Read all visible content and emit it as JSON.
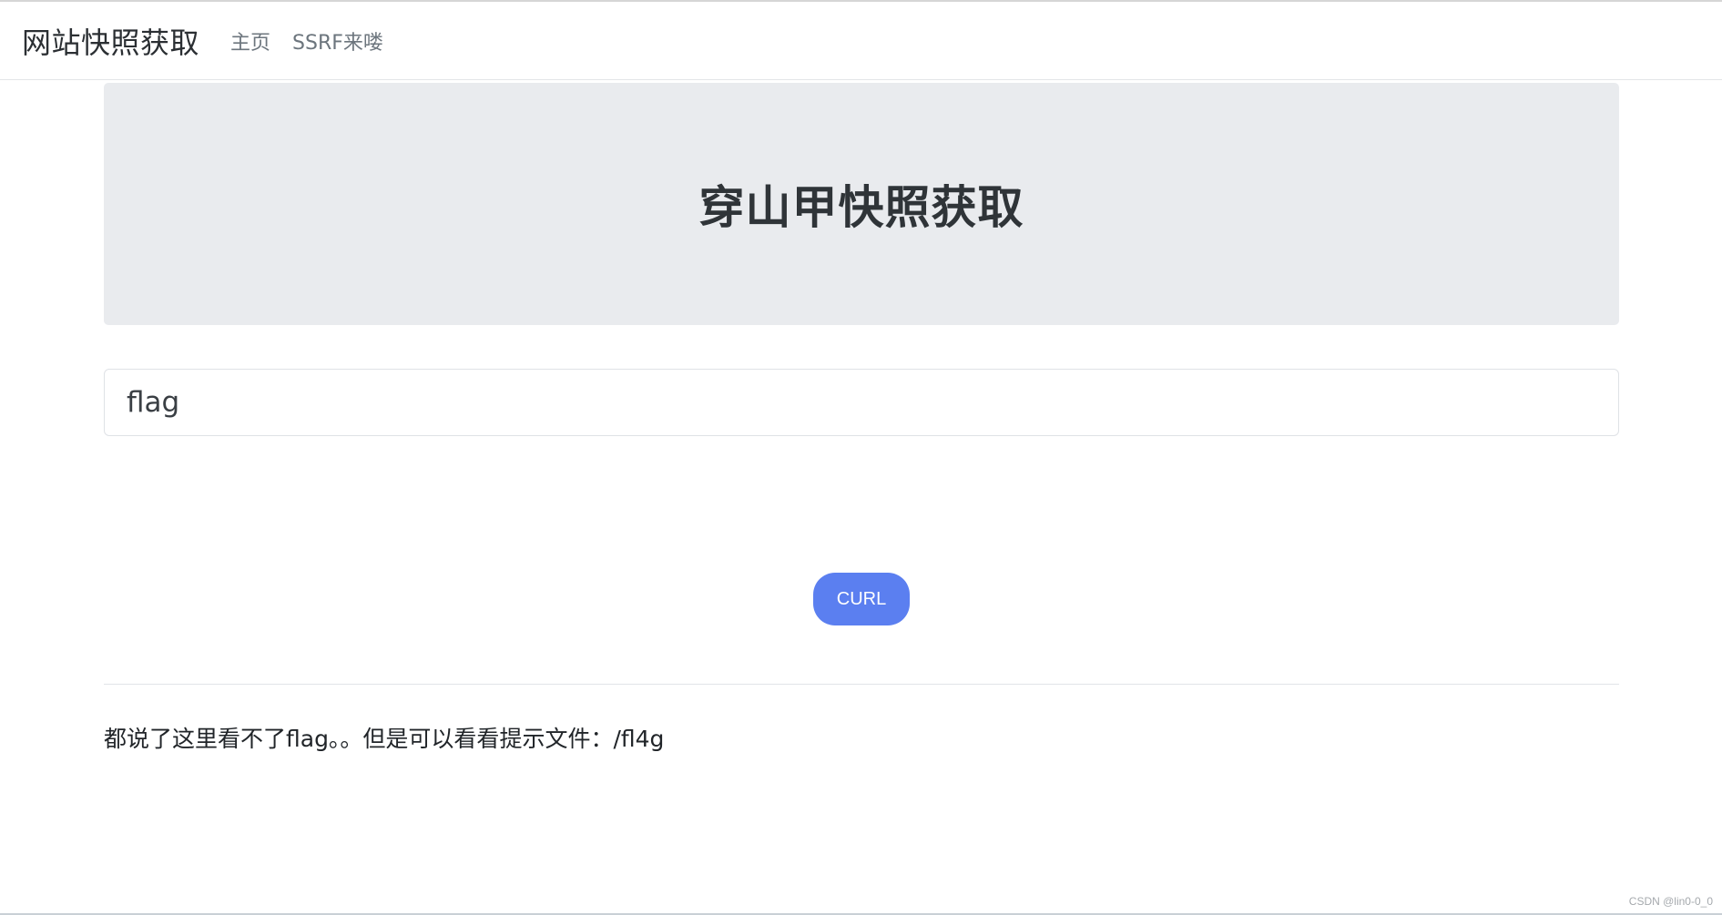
{
  "navbar": {
    "brand": "网站快照获取",
    "links": [
      {
        "label": "主页"
      },
      {
        "label": "SSRF来喽"
      }
    ]
  },
  "jumbotron": {
    "title": "穿山甲快照获取"
  },
  "form": {
    "input_value": "flag",
    "button_label": "CURL"
  },
  "result": {
    "text": "都说了这里看不了flag。。但是可以看看提示文件：/fl4g"
  },
  "watermark": "CSDN @lin0-0_0",
  "colors": {
    "jumbotron_bg": "#e9ebee",
    "button": "#5b7ff0"
  }
}
